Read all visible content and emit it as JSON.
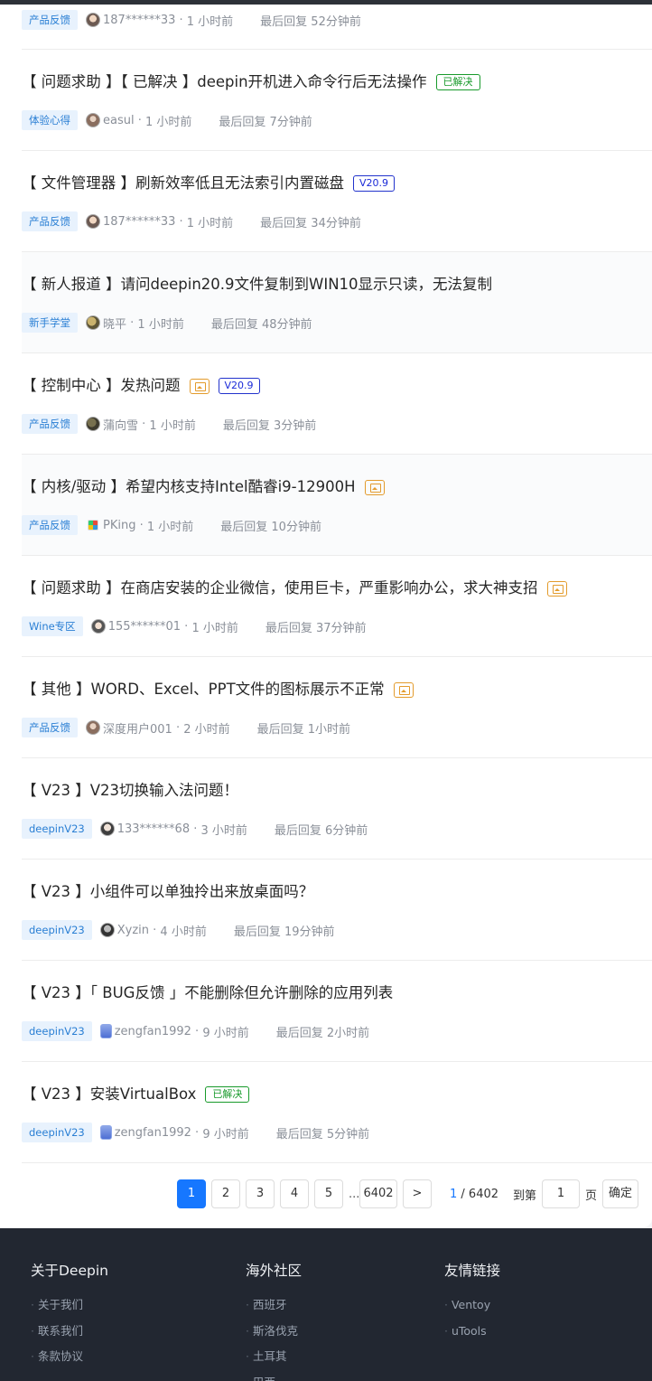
{
  "posts": [
    {
      "cat": "产品反馈",
      "user": "187******33",
      "time": "1 小时前",
      "last_reply": "最后回复 52分钟前"
    },
    {
      "title_pre": "【 问题求助 】【 已解决 】deepin开机进入命令行后无法操作",
      "tag_solved": "已解决",
      "cat": "体验心得",
      "user": "easul",
      "time": "1 小时前",
      "last_reply": "最后回复 7分钟前"
    },
    {
      "title_pre": "【 文件管理器 】刷新效率低且无法索引内置磁盘",
      "tag_ver": "V20.9",
      "cat": "产品反馈",
      "user": "187******33",
      "time": "1 小时前",
      "last_reply": "最后回复 34分钟前"
    },
    {
      "title_pre": "【 新人报道 】请问deepin20.9文件复制到WIN10显示只读，无法复制",
      "cat": "新手学堂",
      "user": "晓平",
      "time": "1 小时前",
      "last_reply": "最后回复 48分钟前"
    },
    {
      "title_pre": "【 控制中心 】发热问题",
      "tag_ver": "V20.9",
      "cat": "产品反馈",
      "user": "蒲向雪",
      "time": "1 小时前",
      "last_reply": "最后回复 3分钟前"
    },
    {
      "title_pre": "【 内核/驱动 】希望内核支持Intel酷睿i9-12900H",
      "cat": "产品反馈",
      "user": "PKing",
      "time": "1 小时前",
      "last_reply": "最后回复 10分钟前"
    },
    {
      "title_pre": "【 问题求助 】在商店安装的企业微信，使用巨卡，严重影响办公，求大神支招",
      "cat": "Wine专区",
      "user": "155******01",
      "time": "1 小时前",
      "last_reply": "最后回复 37分钟前"
    },
    {
      "title_pre": "【 其他 】WORD、Excel、PPT文件的图标展示不正常",
      "cat": "产品反馈",
      "user": "深度用户001",
      "time": "2 小时前",
      "last_reply": "最后回复 1小时前"
    },
    {
      "title_pre": "【 V23 】V23切换输入法问题！",
      "cat": "deepinV23",
      "user": "133******68",
      "time": "3 小时前",
      "last_reply": "最后回复 6分钟前"
    },
    {
      "title_pre": "【 V23 】小组件可以单独拎出来放桌面吗？",
      "cat": "deepinV23",
      "user": "Xyzin",
      "time": "4 小时前",
      "last_reply": "最后回复 19分钟前"
    },
    {
      "title_pre": "【 V23 】「 BUG反馈 」不能删除但允许删除的应用列表",
      "cat": "deepinV23",
      "user": "zengfan1992",
      "time": "9 小时前",
      "last_reply": "最后回复 2小时前"
    },
    {
      "title_pre": "【 V23 】安装VirtualBox",
      "tag_solved": "已解决",
      "cat": "deepinV23",
      "user": "zengfan1992",
      "time": "9 小时前",
      "last_reply": "最后回复 5分钟前"
    }
  ],
  "pagination": {
    "pages": [
      "1",
      "2",
      "3",
      "4",
      "5"
    ],
    "ellipsis": "...",
    "last_page": "6402",
    "next": ">",
    "current": "1",
    "total": "/ 6402",
    "goto_label": "到第",
    "goto_value": "1",
    "page_unit": "页",
    "confirm": "确定"
  },
  "footer": {
    "col1": {
      "title": "关于Deepin",
      "items": [
        "关于我们",
        "联系我们",
        "条款协议"
      ]
    },
    "col2": {
      "title": "海外社区",
      "items": [
        "西班牙",
        "斯洛伐克",
        "土耳其",
        "巴西"
      ]
    },
    "col3": {
      "title": "友情链接",
      "items": [
        "Ventoy",
        "uTools"
      ]
    }
  },
  "colors": {
    "accent": "#1677ff",
    "solved": "#189a2b",
    "version": "#2233cc",
    "footer_bg": "#222731"
  },
  "icons": {
    "image_tag": "image-icon",
    "avatar": "user-avatar"
  }
}
